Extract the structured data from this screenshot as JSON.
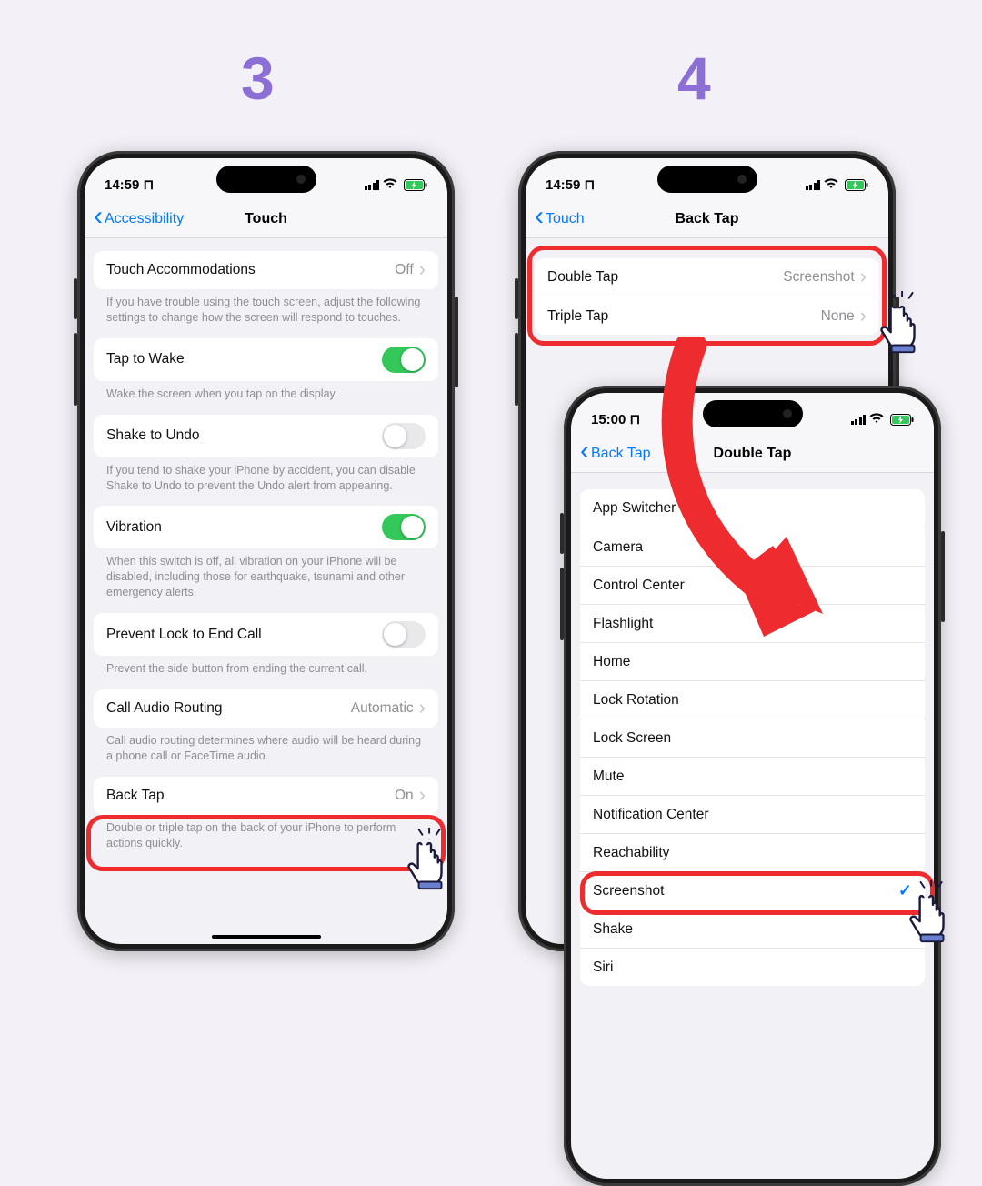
{
  "steps": {
    "left": "3",
    "right": "4"
  },
  "phoneA": {
    "time": "14:59",
    "nav_back": "Accessibility",
    "nav_title": "Touch",
    "rows": {
      "touch_accom": {
        "label": "Touch Accommodations",
        "value": "Off"
      },
      "touch_accom_foot": "If you have trouble using the touch screen, adjust the following settings to change how the screen will respond to touches.",
      "tap_wake": {
        "label": "Tap to Wake"
      },
      "tap_wake_foot": "Wake the screen when you tap on the display.",
      "shake": {
        "label": "Shake to Undo"
      },
      "shake_foot": "If you tend to shake your iPhone by accident, you can disable Shake to Undo to prevent the Undo alert from appearing.",
      "vibration": {
        "label": "Vibration"
      },
      "vibration_foot": "When this switch is off, all vibration on your iPhone will be disabled, including those for earthquake, tsunami and other emergency alerts.",
      "prevent": {
        "label": "Prevent Lock to End Call"
      },
      "prevent_foot": "Prevent the side button from ending the current call.",
      "call_audio": {
        "label": "Call Audio Routing",
        "value": "Automatic"
      },
      "call_audio_foot": "Call audio routing determines where audio will be heard during a phone call or FaceTime audio.",
      "back_tap": {
        "label": "Back Tap",
        "value": "On"
      },
      "back_tap_foot": "Double or triple tap on the back of your iPhone to perform actions quickly."
    }
  },
  "phoneB": {
    "time": "14:59",
    "nav_back": "Touch",
    "nav_title": "Back Tap",
    "rows": {
      "double": {
        "label": "Double Tap",
        "value": "Screenshot"
      },
      "triple": {
        "label": "Triple Tap",
        "value": "None"
      }
    }
  },
  "phoneC": {
    "time": "15:00",
    "nav_back": "Back Tap",
    "nav_title": "Double Tap",
    "options": [
      "App Switcher",
      "Camera",
      "Control Center",
      "Flashlight",
      "Home",
      "Lock Rotation",
      "Lock Screen",
      "Mute",
      "Notification Center",
      "Reachability",
      "Screenshot",
      "Shake",
      "Siri"
    ],
    "selected": "Screenshot"
  }
}
